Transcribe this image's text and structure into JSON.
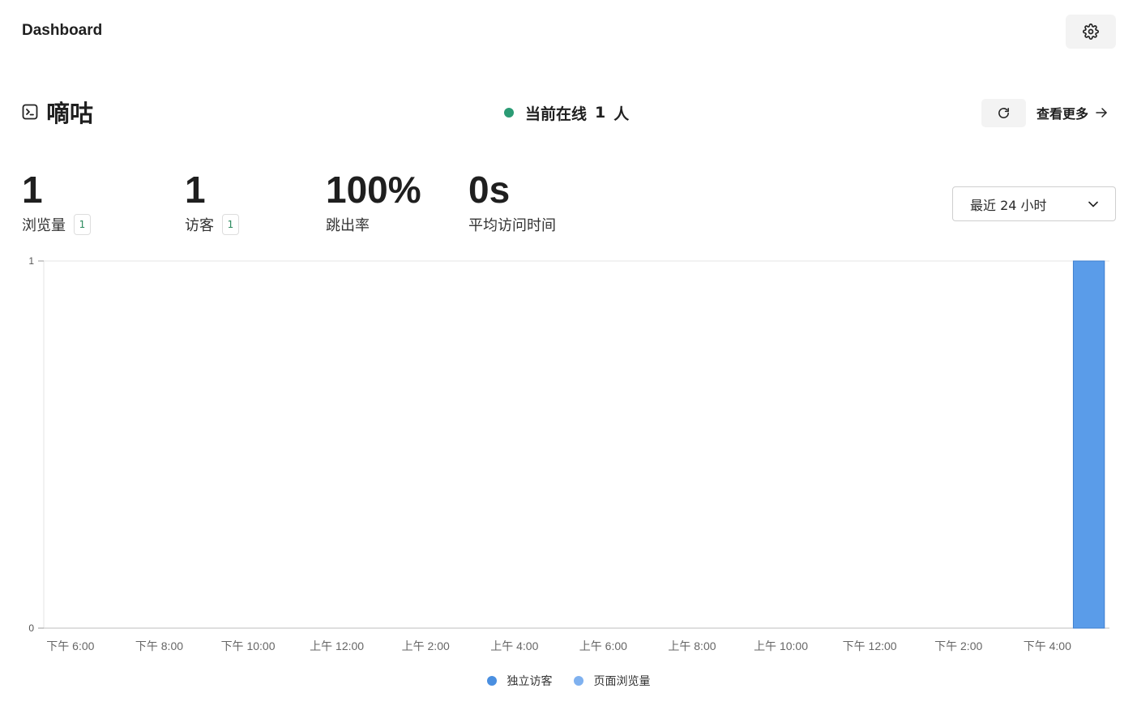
{
  "header": {
    "title": "Dashboard",
    "settings_icon": "gear-icon"
  },
  "site": {
    "name": "嘀咕",
    "icon": "terminal-icon"
  },
  "online": {
    "prefix": "当前在线",
    "count": "1",
    "suffix": "人",
    "dot_color": "#2b9b74"
  },
  "actions": {
    "refresh_icon": "refresh-icon",
    "more_label": "查看更多",
    "more_icon": "arrow-right-icon"
  },
  "metrics": [
    {
      "value": "1",
      "label": "浏览量",
      "badge": "1"
    },
    {
      "value": "1",
      "label": "访客",
      "badge": "1"
    },
    {
      "value": "100%",
      "label": "跳出率"
    },
    {
      "value": "0s",
      "label": "平均访问时间"
    }
  ],
  "range": {
    "selected": "最近 24 小时",
    "icon": "chevron-down-icon"
  },
  "chart_data": {
    "type": "bar",
    "categories": [
      "下午 6:00",
      "下午 8:00",
      "下午 10:00",
      "上午 12:00",
      "上午 2:00",
      "上午 4:00",
      "上午 6:00",
      "上午 8:00",
      "上午 10:00",
      "下午 12:00",
      "下午 2:00",
      "下午 4:00"
    ],
    "series": [
      {
        "name": "独立访客",
        "color": "#4a8fe0",
        "values": [
          0,
          0,
          0,
          0,
          0,
          0,
          0,
          0,
          0,
          0,
          0,
          0,
          0,
          0,
          0,
          0,
          0,
          0,
          0,
          0,
          0,
          0,
          0,
          1
        ]
      },
      {
        "name": "页面浏览量",
        "color": "#7fb1ef",
        "values": [
          0,
          0,
          0,
          0,
          0,
          0,
          0,
          0,
          0,
          0,
          0,
          0,
          0,
          0,
          0,
          0,
          0,
          0,
          0,
          0,
          0,
          0,
          0,
          1
        ]
      }
    ],
    "bar_color": "#5a9ce9",
    "y_ticks": [
      "0",
      "1"
    ],
    "ylim": [
      0,
      1
    ],
    "grid": false,
    "legend": "bottom-center"
  }
}
